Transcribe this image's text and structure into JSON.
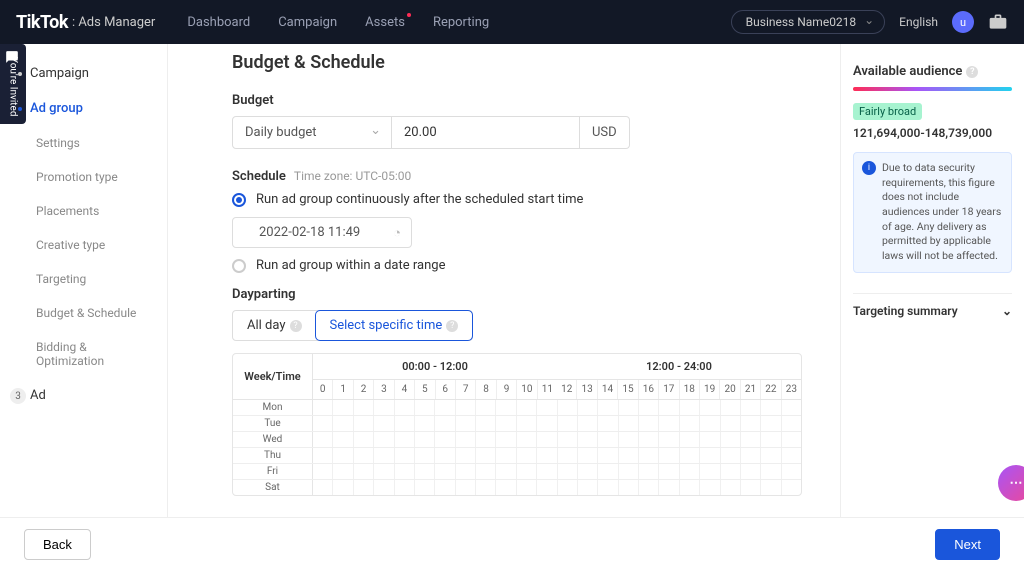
{
  "header": {
    "logo": "TikTok",
    "logo_sub": ": Ads Manager",
    "nav": [
      "Dashboard",
      "Campaign",
      "Assets",
      "Reporting"
    ],
    "business_name": "Business Name0218",
    "language": "English",
    "avatar_letter": "u"
  },
  "invite_label": "You're Invited",
  "sidebar": {
    "items": [
      {
        "label": "Campaign",
        "type": "step"
      },
      {
        "label": "Ad group",
        "type": "step-active"
      },
      {
        "label": "Settings",
        "type": "sub"
      },
      {
        "label": "Promotion type",
        "type": "sub"
      },
      {
        "label": "Placements",
        "type": "sub"
      },
      {
        "label": "Creative type",
        "type": "sub"
      },
      {
        "label": "Targeting",
        "type": "sub"
      },
      {
        "label": "Budget & Schedule",
        "type": "sub"
      },
      {
        "label": "Bidding & Optimization",
        "type": "sub"
      },
      {
        "label": "Ad",
        "type": "badge",
        "badge": "3"
      }
    ]
  },
  "main": {
    "title": "Budget & Schedule",
    "budget_label": "Budget",
    "budget_type": "Daily budget",
    "budget_value": "20.00",
    "currency": "USD",
    "schedule_label": "Schedule",
    "timezone": "Time zone: UTC-05:00",
    "radio1": "Run ad group continuously after the scheduled start time",
    "radio2": "Run ad group within a date range",
    "start_date": "2022-02-18 11:49",
    "dayparting_label": "Dayparting",
    "tab_allday": "All day",
    "tab_specific": "Select specific time",
    "week_time_label": "Week/Time",
    "period_am": "00:00 - 12:00",
    "period_pm": "12:00 - 24:00",
    "hours": [
      "0",
      "1",
      "2",
      "3",
      "4",
      "5",
      "6",
      "7",
      "8",
      "9",
      "10",
      "11",
      "12",
      "13",
      "14",
      "15",
      "16",
      "17",
      "18",
      "19",
      "20",
      "21",
      "22",
      "23"
    ],
    "days": [
      "Mon",
      "Tue",
      "Wed",
      "Thu",
      "Fri",
      "Sat"
    ]
  },
  "right": {
    "title": "Available audience",
    "broad_badge": "Fairly broad",
    "range": "121,694,000-148,739,000",
    "info": "Due to data security requirements, this figure does not include audiences under 18 years of age. Any delivery as permitted by applicable laws will not be affected.",
    "targeting_summary": "Targeting summary"
  },
  "footer": {
    "back": "Back",
    "next": "Next"
  }
}
